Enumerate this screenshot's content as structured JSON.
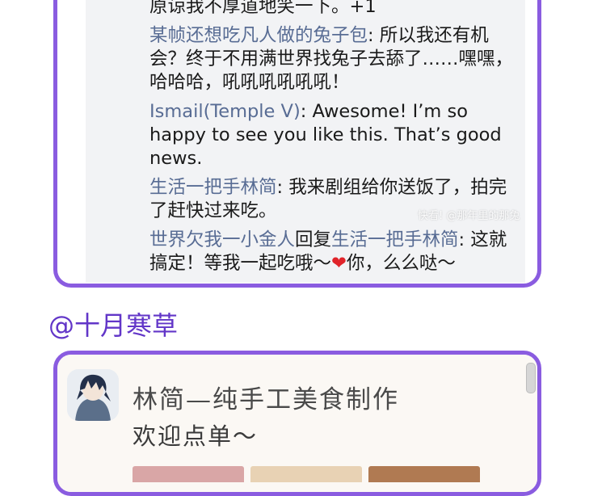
{
  "comments": [
    {
      "parts": [
        {
          "t": "text",
          "v": "原谅我不厚道地笑一下。+1"
        }
      ]
    },
    {
      "parts": [
        {
          "t": "user",
          "v": "某帧还想吃凡人做的兔子包"
        },
        {
          "t": "text",
          "v": ": 所以我还有机会？终于不用满世界找兔子去舔了……嘿嘿，哈哈哈，吼吼吼吼吼吼！"
        }
      ]
    },
    {
      "parts": [
        {
          "t": "user",
          "v": "Ismail(Temple V)"
        },
        {
          "t": "text",
          "v": ": Awesome! I’m so happy to see you like this. That’s good news."
        }
      ]
    },
    {
      "parts": [
        {
          "t": "user",
          "v": "生活一把手林简"
        },
        {
          "t": "text",
          "v": ": 我来剧组给你送饭了，拍完了赶快过来吃。"
        }
      ]
    },
    {
      "parts": [
        {
          "t": "user",
          "v": "世界欠我一小金人"
        },
        {
          "t": "text",
          "v": "回复"
        },
        {
          "t": "user",
          "v": "生活一把手林简"
        },
        {
          "t": "text",
          "v": ": 这就搞定！等我一起吃哦～"
        },
        {
          "t": "heart",
          "v": "❤"
        },
        {
          "t": "text",
          "v": "你，么么哒～"
        }
      ]
    }
  ],
  "watermark": "快看! @那年里的那兔",
  "section_title": "@十月寒草",
  "card": {
    "title": "林简—纯手工美食制作",
    "subtitle": "欢迎点单～"
  },
  "colors": {
    "panel_border": "#8a5ce0",
    "username": "#586c94",
    "section_title": "#6236c8",
    "heart": "#e0242a"
  }
}
